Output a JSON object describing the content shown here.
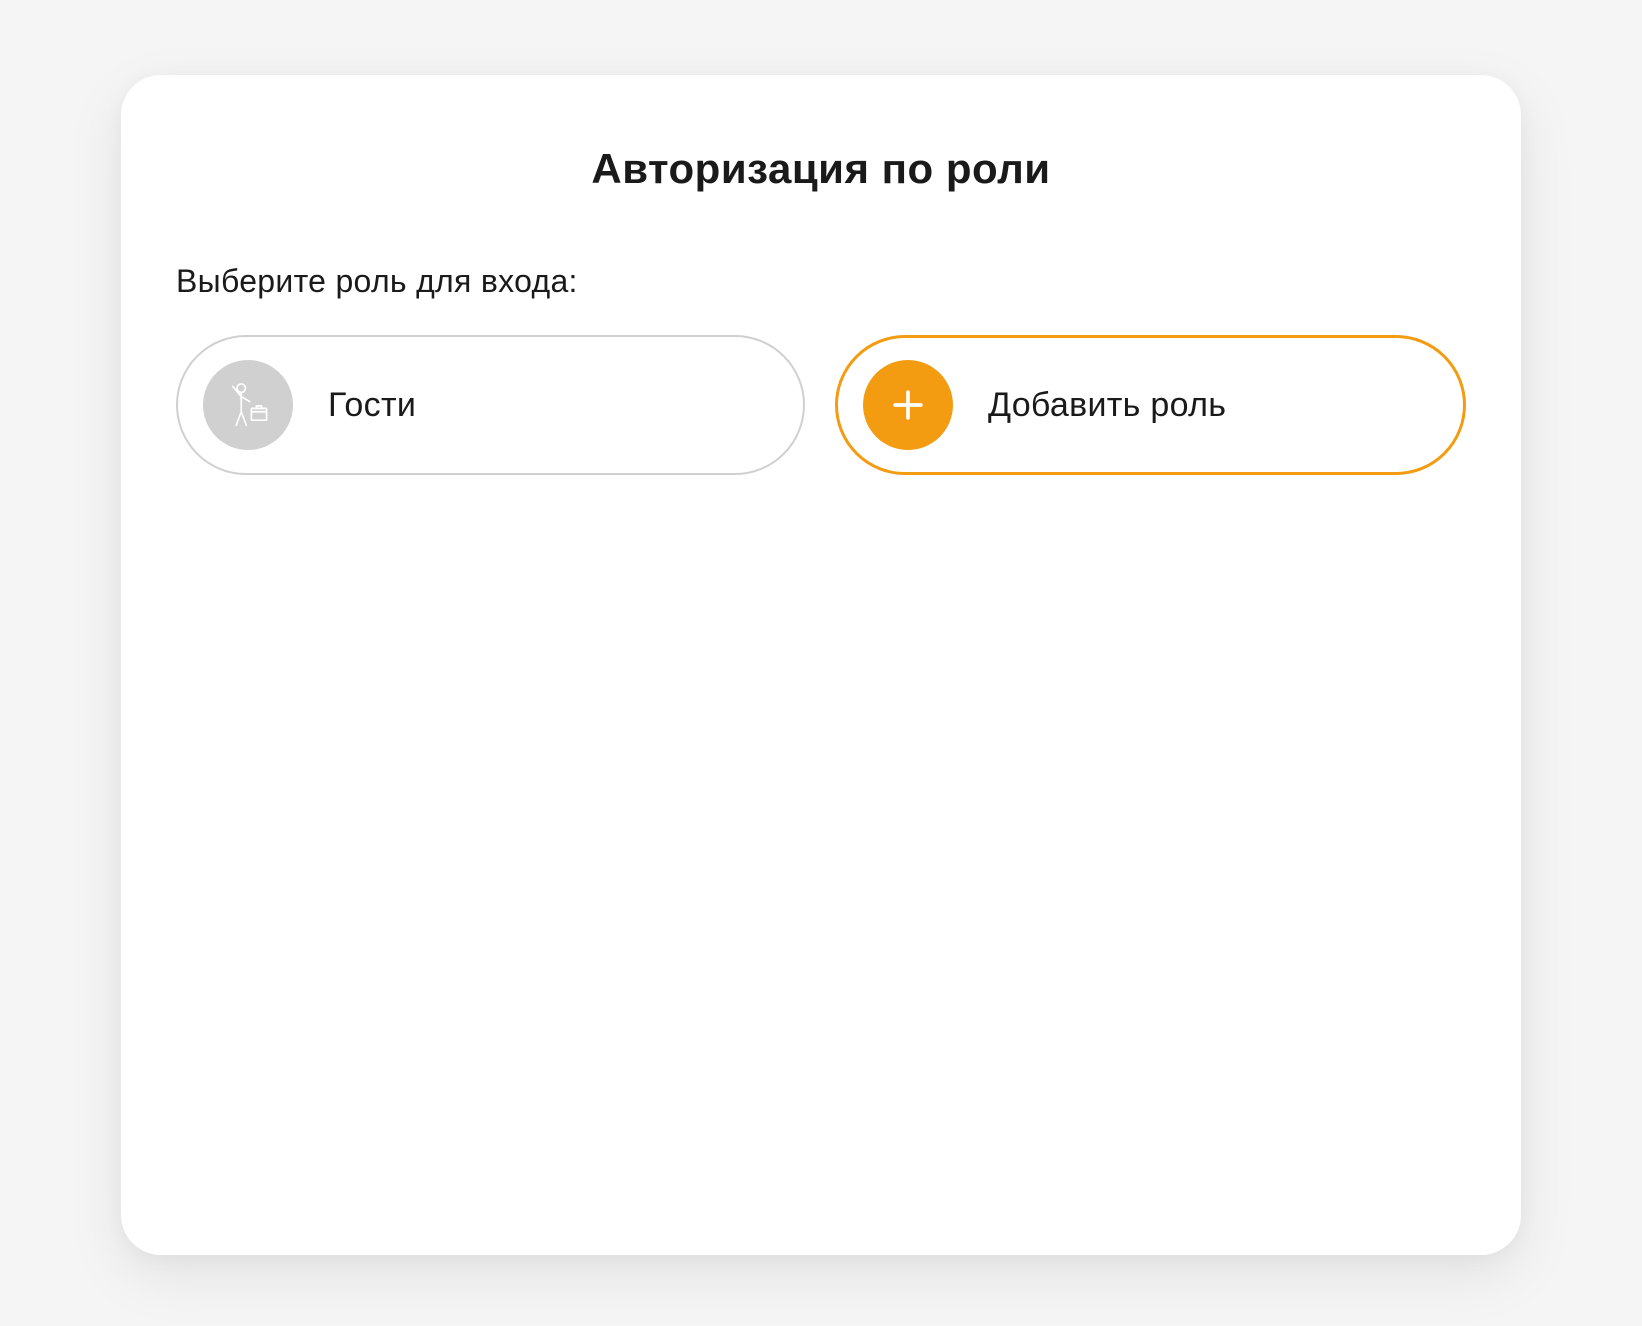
{
  "card": {
    "title": "Авторизация по роли",
    "prompt": "Выберите роль для входа:"
  },
  "roles": {
    "guest": {
      "label": "Гости"
    },
    "add": {
      "label": "Добавить роль"
    }
  },
  "colors": {
    "accent": "#f39c12",
    "muted": "#d0d0d0"
  }
}
